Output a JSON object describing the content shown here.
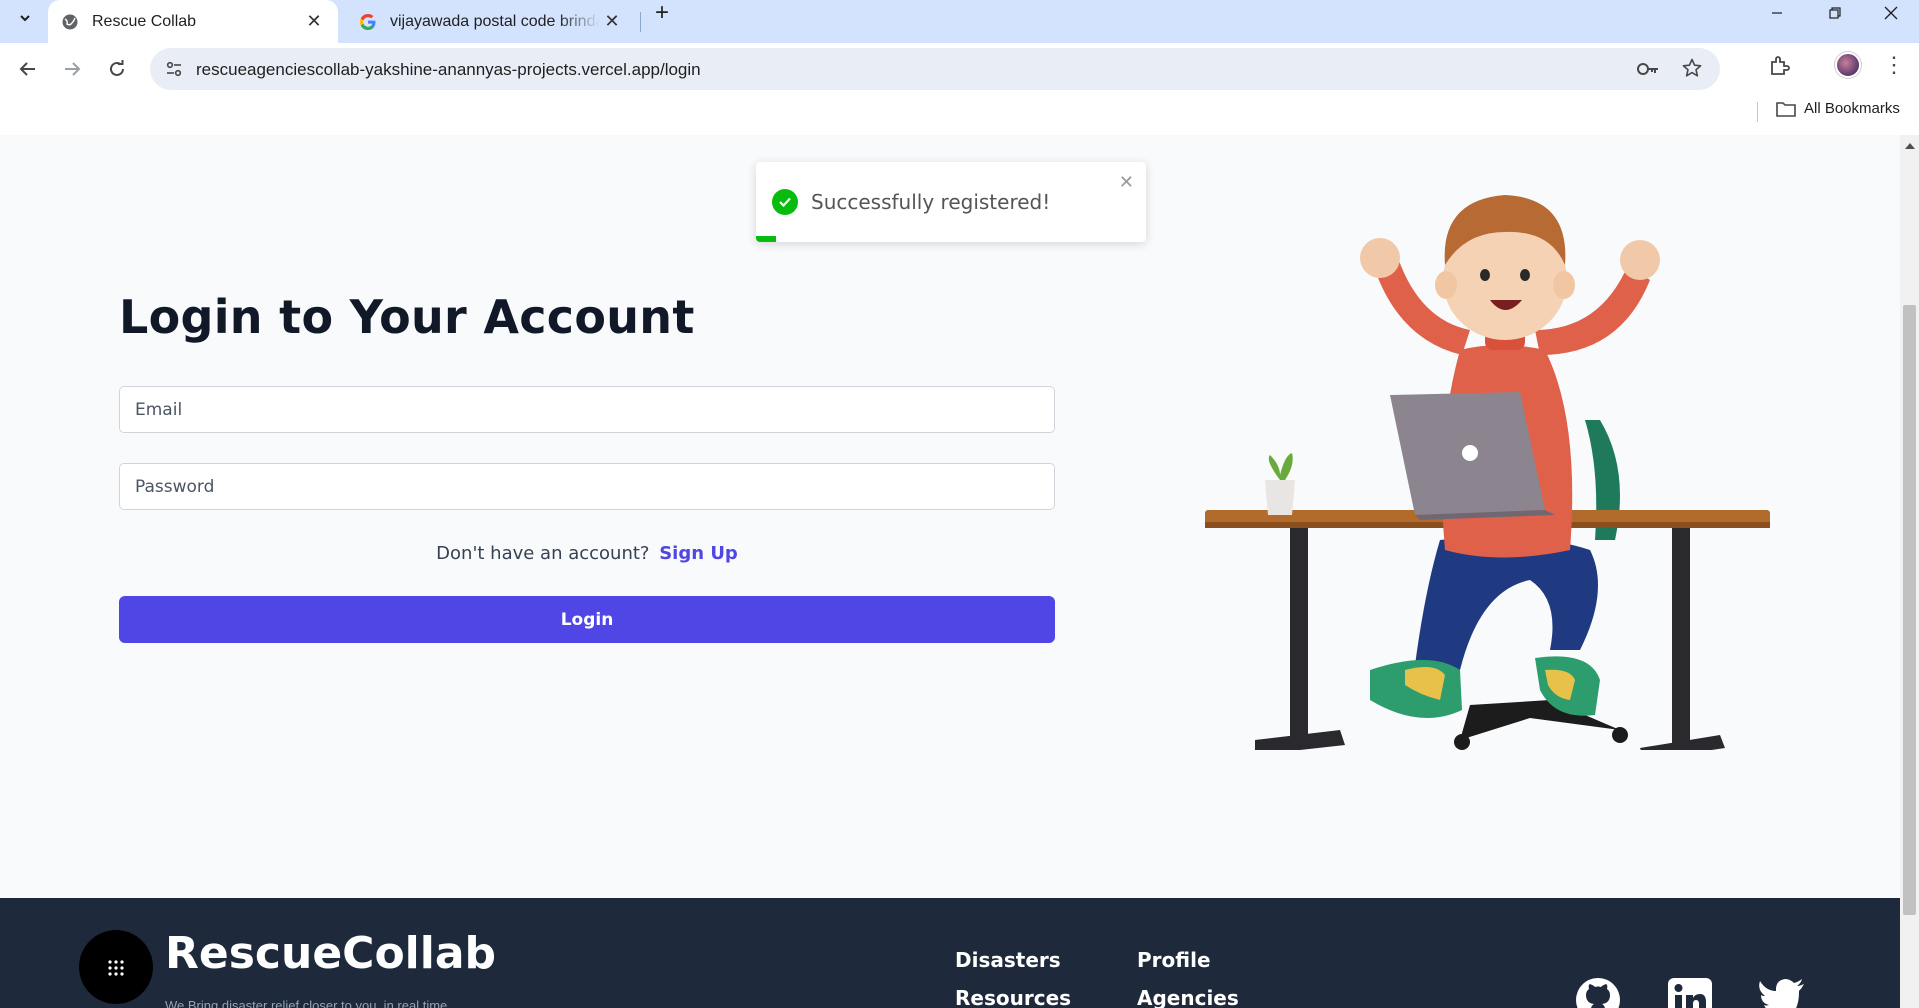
{
  "browser": {
    "tabs": [
      {
        "title": "Rescue Collab",
        "active": true
      },
      {
        "title": "vijayawada postal code brindavan colony",
        "active": false
      }
    ],
    "url": "rescueagenciescollab-yakshine-anannyas-projects.vercel.app/login",
    "bookmarks_label": "All Bookmarks"
  },
  "toast": {
    "message": "Successfully registered!",
    "progress": 0.05,
    "color": "#07bc0c"
  },
  "login": {
    "heading": "Login to Your Account",
    "email_placeholder": "Email",
    "password_placeholder": "Password",
    "signup_prompt": "Don't have an account?",
    "signup_link": "Sign Up",
    "button_label": "Login",
    "accent_color": "#4f46e5"
  },
  "footer": {
    "brand": "RescueCollab",
    "tagline": "We Bring disaster relief closer to you, in real time.",
    "links": [
      "Disasters",
      "Profile",
      "Resources",
      "Agencies"
    ],
    "social_icons": [
      "github-icon",
      "linkedin-icon",
      "twitter-icon"
    ]
  }
}
